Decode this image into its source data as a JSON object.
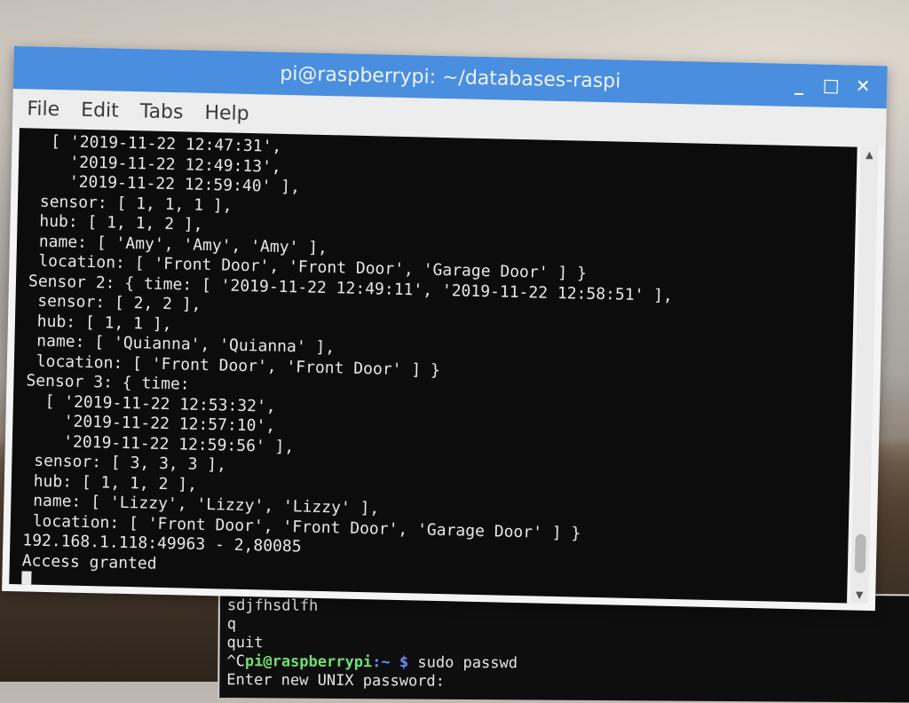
{
  "window": {
    "title": "pi@raspberrypi: ~/databases-raspi",
    "controls": {
      "minimize": "_",
      "maximize": "□",
      "close": "✕"
    },
    "menu": [
      "File",
      "Edit",
      "Tabs",
      "Help"
    ]
  },
  "terminal": {
    "lines": [
      "  [ '2019-11-22 12:47:31',",
      "    '2019-11-22 12:49:13',",
      "    '2019-11-22 12:59:40' ],",
      " sensor: [ 1, 1, 1 ],",
      " hub: [ 1, 1, 2 ],",
      " name: [ 'Amy', 'Amy', 'Amy' ],",
      " location: [ 'Front Door', 'Front Door', 'Garage Door' ] }",
      "Sensor 2: { time: [ '2019-11-22 12:49:11', '2019-11-22 12:58:51' ],",
      " sensor: [ 2, 2 ],",
      " hub: [ 1, 1 ],",
      " name: [ 'Quianna', 'Quianna' ],",
      " location: [ 'Front Door', 'Front Door' ] }",
      "Sensor 3: { time:",
      "  [ '2019-11-22 12:53:32',",
      "    '2019-11-22 12:57:10',",
      "    '2019-11-22 12:59:56' ],",
      " sensor: [ 3, 3, 3 ],",
      " hub: [ 1, 1, 2 ],",
      " name: [ 'Lizzy', 'Lizzy', 'Lizzy' ],",
      " location: [ 'Front Door', 'Front Door', 'Garage Door' ] }",
      "192.168.1.118:49963 - 2,80085",
      "Access granted"
    ]
  },
  "terminal2": {
    "line1": "sdjfhsdlfh",
    "line2": "q",
    "line3": "quit",
    "prompt_prefix": "^C",
    "prompt_user": "pi@raspberrypi",
    "prompt_path": ":~ $",
    "command": " sudo passwd",
    "line5": "Enter new UNIX password:"
  }
}
